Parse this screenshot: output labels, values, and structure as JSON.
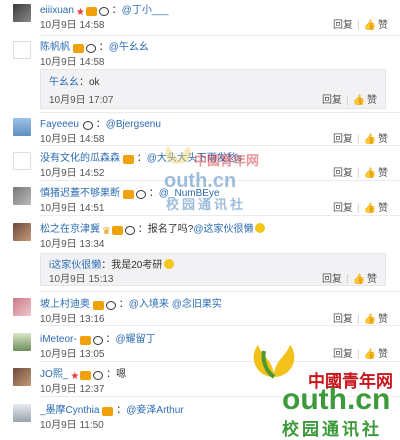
{
  "reply_label": "回复",
  "like_label": "赞",
  "comments": [
    {
      "user": "eiiixuan",
      "badges": [
        "star",
        "vip",
        "panda"
      ],
      "mention": "@丁小___",
      "text": "",
      "time": "10月9日 14:58",
      "avatar": "av-dark"
    },
    {
      "user": "陈帆帆",
      "badges": [
        "vip",
        "panda"
      ],
      "mention": "@午幺幺",
      "text": "",
      "time": "10月9日 14:58",
      "avatar": "av-text"
    },
    {
      "user": "Fayeeeu",
      "badges": [
        "panda"
      ],
      "mention": "@Bjergsenu",
      "text": "",
      "time": "10月9日 14:58",
      "avatar": "av-sky"
    },
    {
      "user": "没有文化的瓜森森",
      "badges": [
        "vip"
      ],
      "mention": "@大头大头下雨发愁s",
      "text": "",
      "time": "10月9日 14:52",
      "avatar": "av-text"
    },
    {
      "user": "慎猪迟蓋不够果断",
      "badges": [
        "vip",
        "panda"
      ],
      "mention": "@_NumBEye",
      "text": "",
      "time": "10月9日 14:51",
      "avatar": "av-gray"
    },
    {
      "user": "松之在京津冀",
      "badges": [
        "crown",
        "vip",
        "panda"
      ],
      "mention": "",
      "text": "：报名了吗?",
      "mention2": "@这家伙很懒",
      "time": "10月9日 13:34",
      "avatar": "av-photo"
    },
    {
      "user": "坡上村迪奥",
      "badges": [
        "vip",
        "panda"
      ],
      "mention": "@入境来",
      "text": "",
      "mention2": "@念旧果实",
      "time": "10月9日 13:16",
      "avatar": "av-pink"
    },
    {
      "user": "iMeteor-",
      "badges": [
        "vip",
        "panda"
      ],
      "mention": "@耀留丁",
      "text": "",
      "time": "10月9日 13:05",
      "avatar": "av-green"
    },
    {
      "user": "JO熙_",
      "badges": [
        "star",
        "vip",
        "panda"
      ],
      "mention": "",
      "text": "：嗯",
      "time": "10月9日 12:37",
      "avatar": "av-photo"
    },
    {
      "user": "_墨摩Cynthia",
      "badges": [
        "vip"
      ],
      "mention": "@妾泽Arthur",
      "text": "",
      "time": "10月9日 11:50",
      "avatar": "av-snow"
    }
  ],
  "nested_replies": [
    {
      "user": "午幺幺",
      "text": "：ok",
      "time": "10月9日 17:07"
    },
    {
      "user": "i这家伙很懒",
      "text": "：我是20考研",
      "time": "10月9日 15:13"
    }
  ],
  "watermark": {
    "brand": "中國青年网",
    "domain": "outh.cn",
    "tagline": "校园通讯社"
  }
}
